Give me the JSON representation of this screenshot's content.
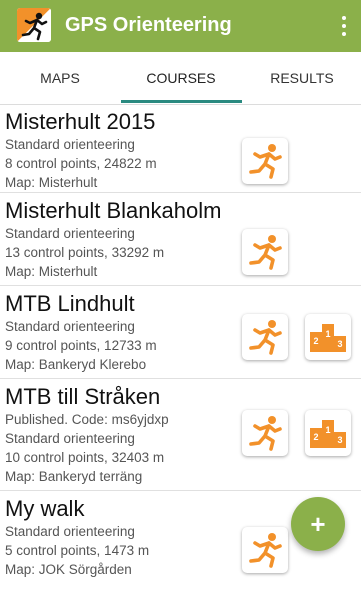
{
  "appbar": {
    "title": "GPS Orienteering"
  },
  "tabs": [
    {
      "label": "MAPS"
    },
    {
      "label": "COURSES"
    },
    {
      "label": "RESULTS"
    }
  ],
  "courses": [
    {
      "name": "Misterhult 2015",
      "lines": [
        "Standard orienteering",
        "8 control points, 24822 m",
        "Map: Misterhult"
      ],
      "results": false
    },
    {
      "name": "Misterhult Blankaholm",
      "lines": [
        "Standard orienteering",
        "13 control points, 33292 m",
        "Map: Misterhult"
      ],
      "results": false
    },
    {
      "name": "MTB Lindhult",
      "lines": [
        "Standard orienteering",
        "9 control points, 12733 m",
        "Map: Bankeryd Klerebo"
      ],
      "results": true
    },
    {
      "name": "MTB till Stråken",
      "lines": [
        "Published. Code: ms6yjdxp",
        "Standard orienteering",
        "10 control points, 32403 m",
        "Map: Bankeryd terräng"
      ],
      "results": true
    },
    {
      "name": "My walk",
      "lines": [
        "Standard orienteering",
        "5 control points, 1473 m",
        "Map: JOK Sörgården"
      ],
      "results": false
    }
  ],
  "podium": {
    "first": "1",
    "second": "2",
    "third": "3"
  },
  "fab": {
    "label": "+"
  },
  "colors": {
    "appbar": "#8bb04a",
    "accent": "#f2912a",
    "tab_indicator": "#2a8a80"
  }
}
